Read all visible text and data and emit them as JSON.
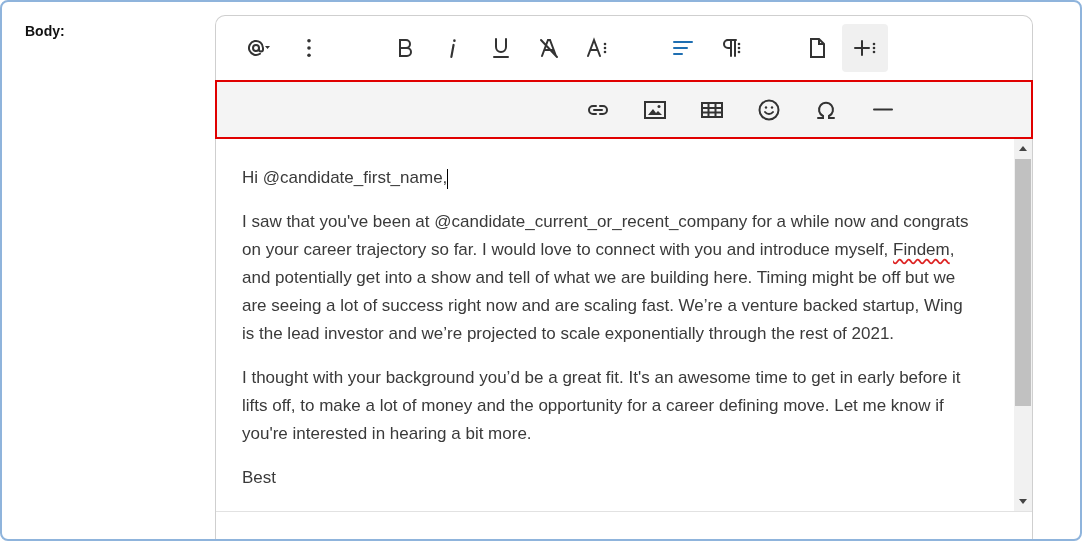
{
  "field_label": "Body:",
  "toolbar": [
    {
      "kind": "mention",
      "active": false,
      "expanded": false
    },
    {
      "kind": "more-vertical",
      "active": false,
      "expanded": false
    },
    {
      "kind": "bold",
      "active": false,
      "expanded": false
    },
    {
      "kind": "italic",
      "active": false,
      "expanded": false
    },
    {
      "kind": "underline",
      "active": false,
      "expanded": false
    },
    {
      "kind": "clear-format",
      "active": false,
      "expanded": false
    },
    {
      "kind": "font-size",
      "active": false,
      "expanded": false
    },
    {
      "kind": "align",
      "active": true,
      "expanded": false
    },
    {
      "kind": "paragraph",
      "active": false,
      "expanded": false
    },
    {
      "kind": "page",
      "active": false,
      "expanded": false
    },
    {
      "kind": "insert-more",
      "active": false,
      "expanded": true
    }
  ],
  "insert_toolbar": {
    "highlighted": true,
    "items": [
      {
        "kind": "link"
      },
      {
        "kind": "image"
      },
      {
        "kind": "table"
      },
      {
        "kind": "emoji"
      },
      {
        "kind": "omega"
      },
      {
        "kind": "rule"
      }
    ]
  },
  "paragraphs": [
    {
      "caret": true,
      "segments": [
        {
          "text": "Hi @candidate_first_name,",
          "misspelled": false
        }
      ]
    },
    {
      "caret": false,
      "segments": [
        {
          "text": "I saw that you've been at @candidate_current_or_recent_company for a while now and congrats on your career trajectory so far. I would love to connect with you and introduce myself, ",
          "misspelled": false
        },
        {
          "text": "Findem",
          "misspelled": true
        },
        {
          "text": ", and potentially get into a show and tell of what we are building here. Timing might be off but we are seeing a lot of success right now and are scaling fast. We’re a venture backed startup, Wing is the lead investor and we’re projected to scale exponentially through the rest of 2021.",
          "misspelled": false
        }
      ]
    },
    {
      "caret": false,
      "segments": [
        {
          "text": "I thought with your background you’d be a great fit. It's an awesome time to get in early before it lifts off, to make a lot of money and the opportunity for a career defining move. Let me know if you're interested in hearing a bit more.",
          "misspelled": false
        }
      ]
    },
    {
      "caret": false,
      "segments": [
        {
          "text": "Best",
          "misspelled": false
        }
      ]
    }
  ]
}
